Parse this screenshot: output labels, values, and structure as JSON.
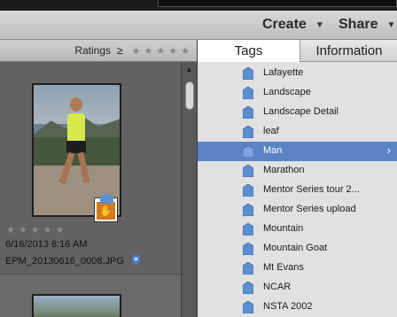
{
  "toolbar": {
    "create_label": "Create",
    "share_label": "Share",
    "caret": "▼"
  },
  "ratings": {
    "label": "Ratings",
    "operator": "≥",
    "stars": [
      "★",
      "★",
      "★",
      "★",
      "★"
    ]
  },
  "photos": [
    {
      "stars": [
        "★",
        "★",
        "★",
        "★",
        "★"
      ],
      "date": "6/16/2013 8:16 AM",
      "filename": "EPM_20130616_0008.JPG"
    }
  ],
  "tabs": {
    "tags": "Tags",
    "information": "Information"
  },
  "tags": [
    {
      "label": "Lafayette"
    },
    {
      "label": "Landscape"
    },
    {
      "label": "Landscape Detail"
    },
    {
      "label": "leaf"
    },
    {
      "label": "Man",
      "selected": true
    },
    {
      "label": "Marathon"
    },
    {
      "label": "Mentor Series tour 2..."
    },
    {
      "label": "Mentor Series upload"
    },
    {
      "label": "Mountain"
    },
    {
      "label": "Mountain Goat"
    },
    {
      "label": "Mt Evans"
    },
    {
      "label": "NCAR"
    },
    {
      "label": "NSTA 2002"
    }
  ],
  "colors": {
    "selection": "#5a84c4",
    "tag_icon": "#5c8fd0",
    "badge": "#d47a1c"
  }
}
